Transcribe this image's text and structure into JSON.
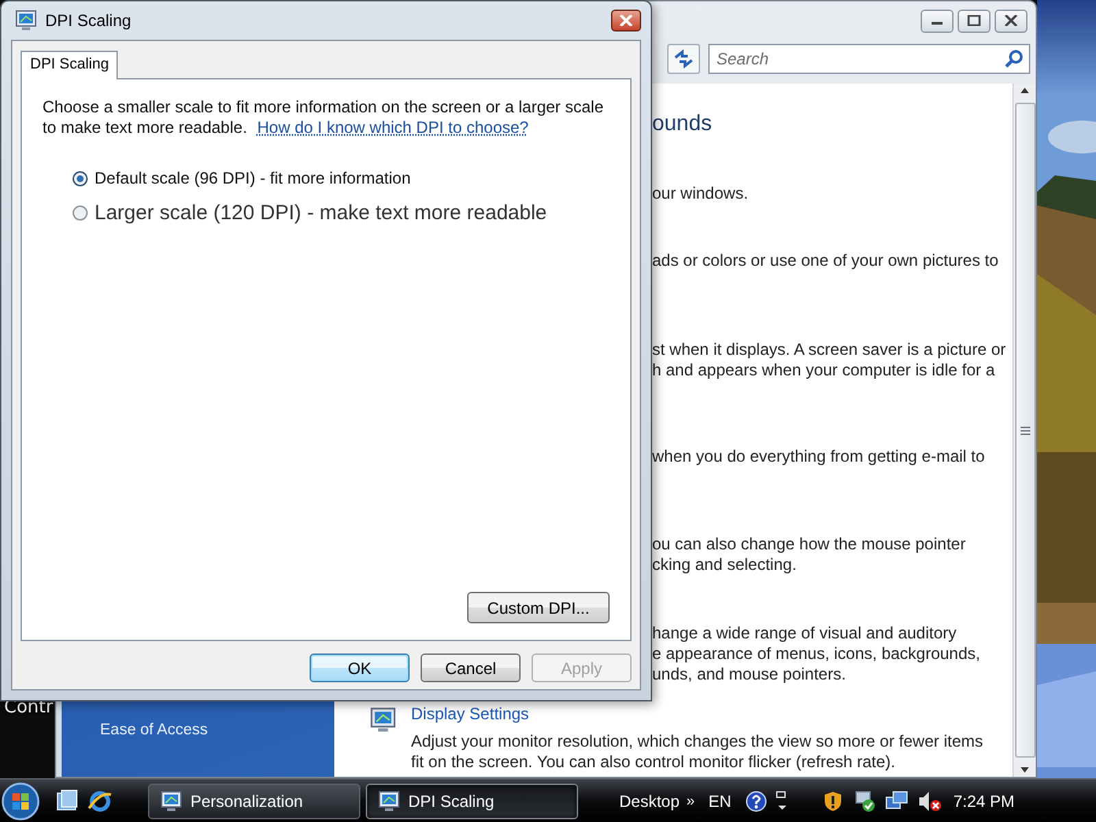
{
  "desktop": {
    "icon_label": "Contr"
  },
  "background_window": {
    "search": {
      "placeholder": "Search"
    },
    "sidebar": {
      "items": [
        "Ease of Access"
      ]
    },
    "fragments": [
      {
        "kind": "heading",
        "lines": [
          "ounds"
        ]
      },
      {
        "kind": "text",
        "lines": [
          "our windows."
        ]
      },
      {
        "kind": "text",
        "lines": [
          "ads or colors or use one of your own pictures to"
        ]
      },
      {
        "kind": "text",
        "lines": [
          "st when it displays. A screen saver is a picture or",
          "h and appears when your computer is idle for a"
        ]
      },
      {
        "kind": "text",
        "lines": [
          "when you do everything from getting e-mail to"
        ]
      },
      {
        "kind": "text",
        "lines": [
          "ou can also change how the mouse pointer",
          "cking and selecting."
        ]
      },
      {
        "kind": "text",
        "lines": [
          "hange a wide range of visual and auditory",
          "e appearance of menus, icons, backgrounds,",
          "unds, and mouse pointers."
        ]
      }
    ],
    "display_settings": {
      "title": "Display Settings",
      "lines": [
        "Adjust your monitor resolution, which changes the view so more or fewer items",
        "fit on the screen. You can also control monitor flicker (refresh rate)."
      ]
    }
  },
  "dialog": {
    "title": "DPI Scaling",
    "tabs": [
      {
        "label": "DPI Scaling",
        "selected": true
      }
    ],
    "description": "Choose a smaller scale to fit more information on the screen or a larger scale to make text more readable.",
    "help_link": "How do I know which DPI to choose?",
    "options": [
      {
        "label": "Default scale (96 DPI) - fit more information",
        "selected": true
      },
      {
        "label": "Larger scale (120 DPI) - make text more readable",
        "selected": false
      }
    ],
    "custom_button": "Custom DPI...",
    "buttons": [
      {
        "label": "OK",
        "default": true,
        "disabled": false
      },
      {
        "label": "Cancel",
        "default": false,
        "disabled": false
      },
      {
        "label": "Apply",
        "default": false,
        "disabled": true
      }
    ]
  },
  "taskbar": {
    "tasks": [
      {
        "label": "Personalization",
        "selected": false
      },
      {
        "label": "DPI Scaling",
        "selected": true
      }
    ],
    "toolbar": "Desktop",
    "chevron": "»",
    "language": "EN",
    "clock": "7:24 PM"
  }
}
